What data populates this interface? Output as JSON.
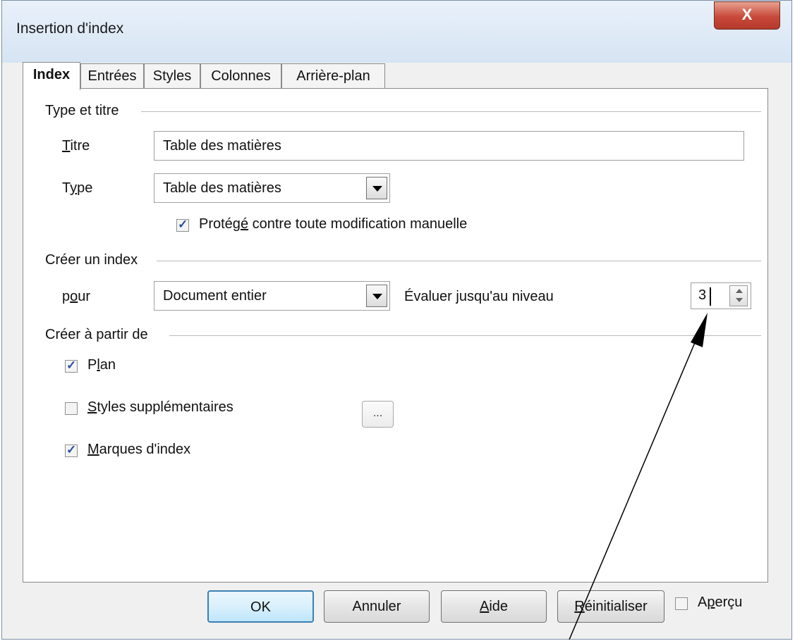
{
  "window": {
    "title": "Insertion d'index",
    "close_label": "X"
  },
  "tabs": [
    {
      "label": "Index",
      "active": true
    },
    {
      "label": "Entrées"
    },
    {
      "label": "Styles"
    },
    {
      "label": "Colonnes"
    },
    {
      "label": "Arrière-plan"
    }
  ],
  "type_section": {
    "heading": "Type et titre",
    "title_label_u": "T",
    "title_label_rest": "itre",
    "title_value": "Table des matières",
    "type_label_a": "T",
    "type_label_u": "y",
    "type_label_b": "pe",
    "type_value": "Table des matières",
    "protected_a": "Protég",
    "protected_u": "é",
    "protected_b": " contre toute modification manuelle",
    "protected_checked": true
  },
  "create_section": {
    "heading": "Créer un index",
    "for_label_a": "p",
    "for_label_u": "o",
    "for_label_b": "ur",
    "for_value": "Document entier",
    "level_label_a": "Évaluer ",
    "level_label_u": "j",
    "level_label_b": "usqu'au niveau",
    "level_value": "3"
  },
  "from_section": {
    "heading": "Créer à partir de",
    "outline_a": "P",
    "outline_u": "l",
    "outline_b": "an",
    "outline_checked": true,
    "styles_u": "S",
    "styles_b": "tyles supplémentaires",
    "styles_checked": false,
    "styles_button": "...",
    "marks_u": "M",
    "marks_b": "arques d'index",
    "marks_checked": true
  },
  "buttons": {
    "ok": "OK",
    "cancel": "Annuler",
    "help_u": "A",
    "help_b": "ide",
    "reset_u": "R",
    "reset_b": "éinitialiser",
    "preview_a": "A",
    "preview_u": "p",
    "preview_b": "erçu",
    "preview_checked": false
  }
}
